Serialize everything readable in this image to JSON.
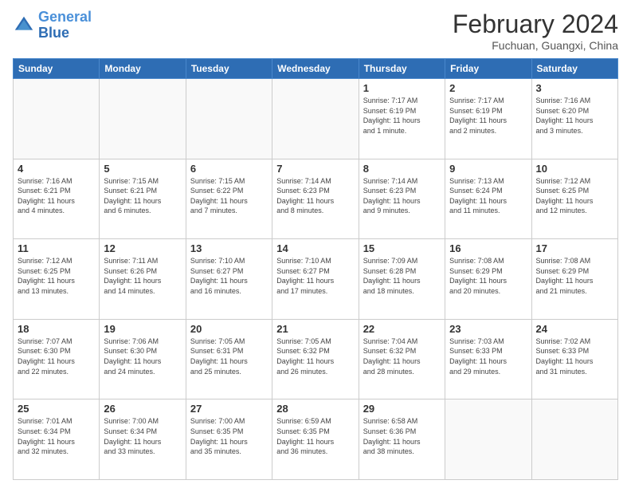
{
  "header": {
    "logo_line1": "General",
    "logo_line2": "Blue",
    "month_year": "February 2024",
    "location": "Fuchuan, Guangxi, China"
  },
  "days_of_week": [
    "Sunday",
    "Monday",
    "Tuesday",
    "Wednesday",
    "Thursday",
    "Friday",
    "Saturday"
  ],
  "weeks": [
    [
      {
        "day": "",
        "info": ""
      },
      {
        "day": "",
        "info": ""
      },
      {
        "day": "",
        "info": ""
      },
      {
        "day": "",
        "info": ""
      },
      {
        "day": "1",
        "info": "Sunrise: 7:17 AM\nSunset: 6:19 PM\nDaylight: 11 hours\nand 1 minute."
      },
      {
        "day": "2",
        "info": "Sunrise: 7:17 AM\nSunset: 6:19 PM\nDaylight: 11 hours\nand 2 minutes."
      },
      {
        "day": "3",
        "info": "Sunrise: 7:16 AM\nSunset: 6:20 PM\nDaylight: 11 hours\nand 3 minutes."
      }
    ],
    [
      {
        "day": "4",
        "info": "Sunrise: 7:16 AM\nSunset: 6:21 PM\nDaylight: 11 hours\nand 4 minutes."
      },
      {
        "day": "5",
        "info": "Sunrise: 7:15 AM\nSunset: 6:21 PM\nDaylight: 11 hours\nand 6 minutes."
      },
      {
        "day": "6",
        "info": "Sunrise: 7:15 AM\nSunset: 6:22 PM\nDaylight: 11 hours\nand 7 minutes."
      },
      {
        "day": "7",
        "info": "Sunrise: 7:14 AM\nSunset: 6:23 PM\nDaylight: 11 hours\nand 8 minutes."
      },
      {
        "day": "8",
        "info": "Sunrise: 7:14 AM\nSunset: 6:23 PM\nDaylight: 11 hours\nand 9 minutes."
      },
      {
        "day": "9",
        "info": "Sunrise: 7:13 AM\nSunset: 6:24 PM\nDaylight: 11 hours\nand 11 minutes."
      },
      {
        "day": "10",
        "info": "Sunrise: 7:12 AM\nSunset: 6:25 PM\nDaylight: 11 hours\nand 12 minutes."
      }
    ],
    [
      {
        "day": "11",
        "info": "Sunrise: 7:12 AM\nSunset: 6:25 PM\nDaylight: 11 hours\nand 13 minutes."
      },
      {
        "day": "12",
        "info": "Sunrise: 7:11 AM\nSunset: 6:26 PM\nDaylight: 11 hours\nand 14 minutes."
      },
      {
        "day": "13",
        "info": "Sunrise: 7:10 AM\nSunset: 6:27 PM\nDaylight: 11 hours\nand 16 minutes."
      },
      {
        "day": "14",
        "info": "Sunrise: 7:10 AM\nSunset: 6:27 PM\nDaylight: 11 hours\nand 17 minutes."
      },
      {
        "day": "15",
        "info": "Sunrise: 7:09 AM\nSunset: 6:28 PM\nDaylight: 11 hours\nand 18 minutes."
      },
      {
        "day": "16",
        "info": "Sunrise: 7:08 AM\nSunset: 6:29 PM\nDaylight: 11 hours\nand 20 minutes."
      },
      {
        "day": "17",
        "info": "Sunrise: 7:08 AM\nSunset: 6:29 PM\nDaylight: 11 hours\nand 21 minutes."
      }
    ],
    [
      {
        "day": "18",
        "info": "Sunrise: 7:07 AM\nSunset: 6:30 PM\nDaylight: 11 hours\nand 22 minutes."
      },
      {
        "day": "19",
        "info": "Sunrise: 7:06 AM\nSunset: 6:30 PM\nDaylight: 11 hours\nand 24 minutes."
      },
      {
        "day": "20",
        "info": "Sunrise: 7:05 AM\nSunset: 6:31 PM\nDaylight: 11 hours\nand 25 minutes."
      },
      {
        "day": "21",
        "info": "Sunrise: 7:05 AM\nSunset: 6:32 PM\nDaylight: 11 hours\nand 26 minutes."
      },
      {
        "day": "22",
        "info": "Sunrise: 7:04 AM\nSunset: 6:32 PM\nDaylight: 11 hours\nand 28 minutes."
      },
      {
        "day": "23",
        "info": "Sunrise: 7:03 AM\nSunset: 6:33 PM\nDaylight: 11 hours\nand 29 minutes."
      },
      {
        "day": "24",
        "info": "Sunrise: 7:02 AM\nSunset: 6:33 PM\nDaylight: 11 hours\nand 31 minutes."
      }
    ],
    [
      {
        "day": "25",
        "info": "Sunrise: 7:01 AM\nSunset: 6:34 PM\nDaylight: 11 hours\nand 32 minutes."
      },
      {
        "day": "26",
        "info": "Sunrise: 7:00 AM\nSunset: 6:34 PM\nDaylight: 11 hours\nand 33 minutes."
      },
      {
        "day": "27",
        "info": "Sunrise: 7:00 AM\nSunset: 6:35 PM\nDaylight: 11 hours\nand 35 minutes."
      },
      {
        "day": "28",
        "info": "Sunrise: 6:59 AM\nSunset: 6:35 PM\nDaylight: 11 hours\nand 36 minutes."
      },
      {
        "day": "29",
        "info": "Sunrise: 6:58 AM\nSunset: 6:36 PM\nDaylight: 11 hours\nand 38 minutes."
      },
      {
        "day": "",
        "info": ""
      },
      {
        "day": "",
        "info": ""
      }
    ]
  ]
}
